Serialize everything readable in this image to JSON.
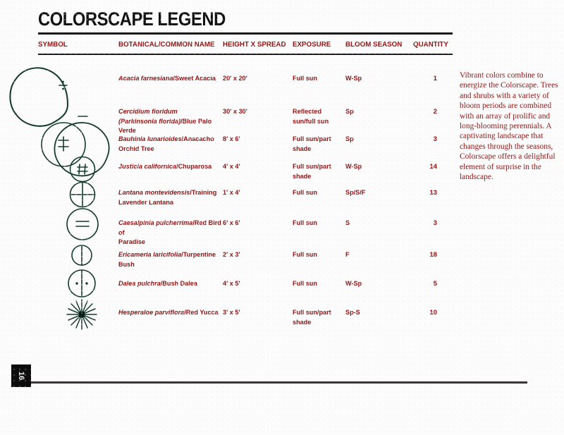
{
  "title": "COLORSCAPE LEGEND",
  "colors": {
    "heading_text": "#111111",
    "table_text": "#8f1111",
    "column_header": "#9b1010",
    "rule": "#1a1a1a",
    "page_background": "#fdfcfc",
    "page_number_background": "#0d0d0d",
    "page_number_text": "#f2eeee"
  },
  "table": {
    "columns": [
      {
        "key": "symbol",
        "label": "SYMBOL"
      },
      {
        "key": "name",
        "label": "BOTANICAL/COMMON NAME"
      },
      {
        "key": "size",
        "label": "HEIGHT X SPREAD"
      },
      {
        "key": "exposure",
        "label": "EXPOSURE"
      },
      {
        "key": "bloom",
        "label": "BLOOM SEASON"
      },
      {
        "key": "quantity",
        "label": "QUANTITY"
      }
    ],
    "rows": [
      {
        "symbol_icon": "large-circle-divide-symbol",
        "botanical": "Acacia farnesiana",
        "common": "/Sweet Acacia",
        "size": "20' x 20'",
        "exposure": "Full sun",
        "bloom": "W-Sp",
        "quantity": "1"
      },
      {
        "symbol_icon": "large-circle-minus-symbol",
        "botanical": "Cercidium floridum\n(Parkinsonia florida)",
        "common": "/Blue Palo Verde",
        "size": "30' x 30'",
        "exposure": "Reflected\nsun/full sun",
        "bloom": "Sp",
        "quantity": "2"
      },
      {
        "symbol_icon": "medium-circle-double-dagger-symbol",
        "botanical": "Bauhinia lunarioides",
        "common": "/Anacacho\nOrchid Tree",
        "size": "8' x 6'",
        "exposure": "Full sun/part\nshade",
        "bloom": "Sp",
        "quantity": "3"
      },
      {
        "symbol_icon": "circle-hash-symbol",
        "botanical": "Justicia californica",
        "common": "/Chuparosa",
        "size": "4' x 4'",
        "exposure": "Full sun/part\nshade",
        "bloom": "W-Sp",
        "quantity": "14"
      },
      {
        "symbol_icon": "circle-crosshair-symbol",
        "botanical": "Lantana montevidensis",
        "common": "/Training\nLavender Lantana",
        "size": "1' x 4'",
        "exposure": "Full sun",
        "bloom": "Sp/S/F",
        "quantity": "13"
      },
      {
        "symbol_icon": "circle-equals-symbol",
        "botanical": "Caesalpinia pulcherrima",
        "common": "/Red Bird of\nParadise",
        "size": "6' x 6'",
        "exposure": "Full sun",
        "bloom": "S",
        "quantity": "3"
      },
      {
        "symbol_icon": "circle-vertical-line-symbol",
        "botanical": "Ericameria laricifolia",
        "common": "/Turpentine Bush",
        "size": "2' x 3'",
        "exposure": "Full sun",
        "bloom": "F",
        "quantity": "18"
      },
      {
        "symbol_icon": "circle-vertical-line-dots-symbol",
        "botanical": "Dalea pulchra",
        "common": "/Bush Dalea",
        "size": "4' x 5'",
        "exposure": "Full sun",
        "bloom": "W-Sp",
        "quantity": "5"
      },
      {
        "symbol_icon": "starburst-symbol",
        "botanical": "Hesperaloe parviflora",
        "common": "/Red Yucca",
        "size": "3' x 5'",
        "exposure": "Full sun/part\nshade",
        "bloom": "Sp-S",
        "quantity": "10"
      }
    ]
  },
  "side_note": "Vibrant colors combine to energize the Colorscape. Trees and shrubs with a variety of bloom periods are combined with an array of prolific and long-blooming perennials.  A captivating landscape that changes through the seasons, Colorscape offers a delightful element of surprise in the landscape.",
  "footer": {
    "page_number": "16"
  }
}
